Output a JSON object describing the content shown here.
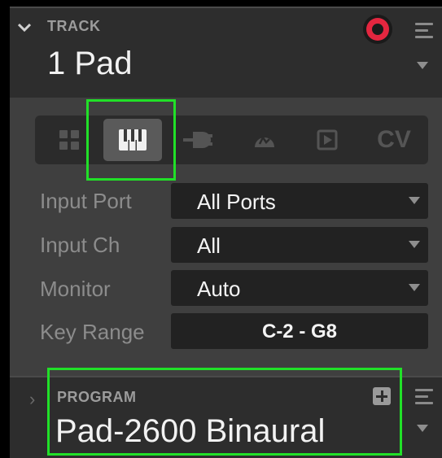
{
  "track": {
    "section_label": "TRACK",
    "name": "1 Pad"
  },
  "mode_bar": {
    "buttons": [
      {
        "icon": "pad-grid-icon"
      },
      {
        "icon": "keyboard-icon",
        "active": true
      },
      {
        "icon": "plug-icon"
      },
      {
        "icon": "audio-input-icon"
      },
      {
        "icon": "plugin-icon"
      },
      {
        "label": "CV"
      }
    ]
  },
  "fields": {
    "input_port": {
      "label": "Input Port",
      "value": "All Ports"
    },
    "input_ch": {
      "label": "Input Ch",
      "value": "All"
    },
    "monitor": {
      "label": "Monitor",
      "value": "Auto"
    },
    "key_range": {
      "label": "Key Range",
      "value": "C-2 - G8"
    }
  },
  "program": {
    "section_label": "PROGRAM",
    "name": "Pad-2600 Binaural"
  },
  "colors": {
    "record": "#e3263f",
    "highlight": "#21e028",
    "panel": "#3f3f3f",
    "header": "#2d2d2d"
  }
}
